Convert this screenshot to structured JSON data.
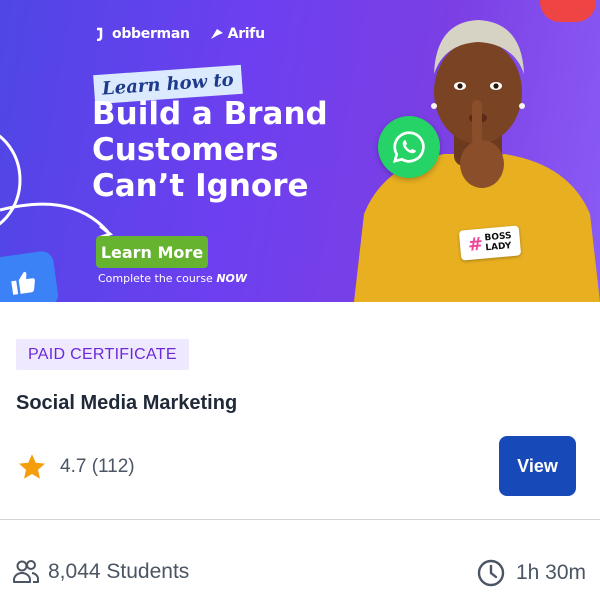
{
  "banner": {
    "logo_left": "obberman",
    "logo_right": "Arifu",
    "tagline": "Learn how to",
    "headline_lines": [
      "Build a Brand",
      "Customers",
      "Can’t Ignore"
    ],
    "cta_label": "Learn More",
    "complete_prefix": "Complete the course ",
    "complete_emphasis": "NOW",
    "sticker_hash": "#",
    "sticker_line1": "BOSS",
    "sticker_line2": "LADY"
  },
  "course": {
    "badge": "PAID CERTIFICATE",
    "title": "Social Media Marketing",
    "rating": "4.7 (112)",
    "view_label": "View",
    "students": "8,044 Students",
    "duration": "1h 30m"
  },
  "colors": {
    "badge_bg": "#efe9ff",
    "badge_text": "#6d28d9",
    "view_button": "#1849b8",
    "star": "#f59e0b",
    "cta_green": "#65b32e"
  },
  "icons": {
    "rating": "star-icon",
    "students": "users-icon",
    "duration": "clock-icon",
    "chat": "whatsapp-icon",
    "like": "thumbs-up-icon"
  }
}
